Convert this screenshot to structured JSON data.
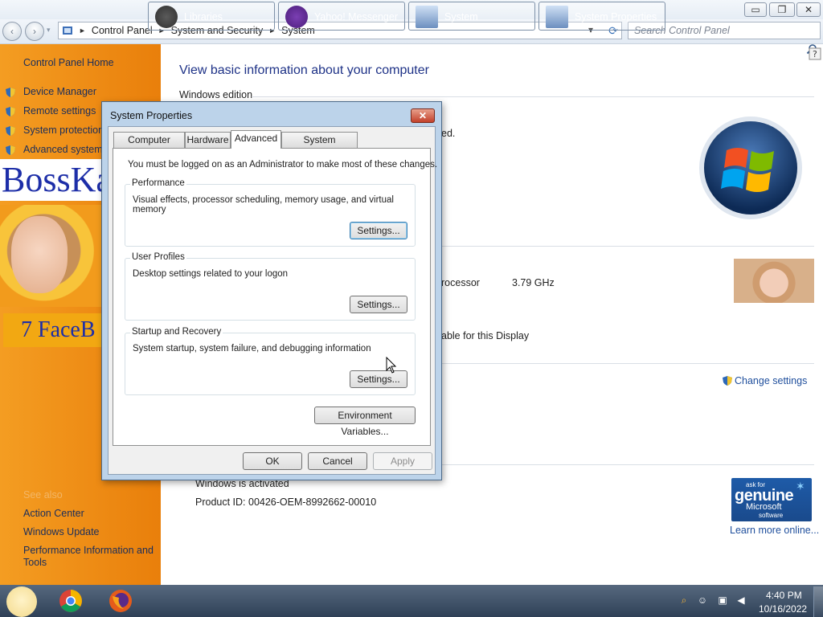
{
  "window": {
    "minimize": "▭",
    "maximize": "❐",
    "close": "✕"
  },
  "address": {
    "back": "‹",
    "forward": "›",
    "crumbs": [
      "Control Panel",
      "System and Security",
      "System"
    ],
    "search_placeholder": "Search Control Panel",
    "dropdown": "▾",
    "refresh": "⟳"
  },
  "sidebar": {
    "home": "Control Panel Home",
    "links": [
      "Device Manager",
      "Remote settings",
      "System protection",
      "Advanced system"
    ],
    "banner_text": "BossKa",
    "banner_fb": "7 FaceB",
    "see_also": "See also",
    "see_also_links": [
      "Action Center",
      "Windows Update",
      "Performance Information and",
      "Tools"
    ]
  },
  "main": {
    "title": "View basic information about your computer",
    "windows_edition": "Windows edition",
    "fragment_ed": "ed.",
    "processor_label": "rocessor",
    "processor_value": "3.79 GHz",
    "display_text": "able for this Display",
    "change_settings": "Change settings",
    "activated": "Windows is activated",
    "product_id": "Product ID: 00426-OEM-8992662-00010",
    "genuine": {
      "ask": "ask for",
      "genuine": "genuine",
      "microsoft": "Microsoft",
      "software": "software"
    },
    "learn_more": "Learn more online..."
  },
  "dialog": {
    "title": "System Properties",
    "close": "✕",
    "tabs": [
      "Computer Name",
      "Hardware",
      "Advanced",
      "System Protection"
    ],
    "active_tab": "Advanced",
    "admin_note": "You must be logged on as an Administrator to make most of these changes.",
    "groups": [
      {
        "title": "Performance",
        "desc": "Visual effects, processor scheduling, memory usage, and virtual memory",
        "button": "Settings..."
      },
      {
        "title": "User Profiles",
        "desc": "Desktop settings related to your logon",
        "button": "Settings..."
      },
      {
        "title": "Startup and Recovery",
        "desc": "System startup, system failure, and debugging information",
        "button": "Settings..."
      }
    ],
    "env_button": "Environment Variables...",
    "ok": "OK",
    "cancel": "Cancel",
    "apply": "Apply"
  },
  "taskbar": {
    "items": [
      "Libraries",
      "Yahoo! Messenger",
      "System",
      "System Properties"
    ],
    "time": "4:40 PM",
    "date": "10/16/2022"
  },
  "colors": {
    "sidebar_orange": "#f49d22",
    "link_blue": "#1e4e9c",
    "title_blue": "#1e3287"
  }
}
